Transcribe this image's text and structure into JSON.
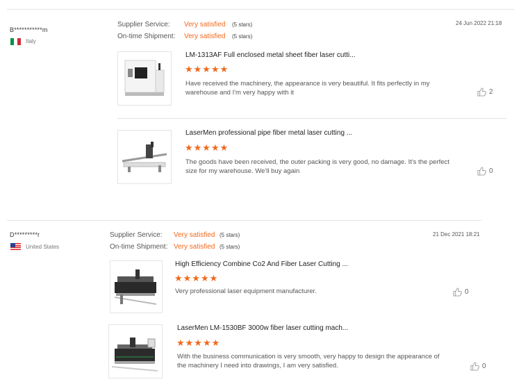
{
  "reviews": [
    {
      "user": "B***********m",
      "country": "Italy",
      "supplier_label": "Supplier Service:",
      "supplier_value": "Very satisfied",
      "supplier_stars": "(5 stars)",
      "shipment_label": "On-time Shipment:",
      "shipment_value": "Very satisfied",
      "shipment_stars": "(5 stars)",
      "date": "24 Jun 2022 21:18",
      "items": [
        {
          "title": "LM-1313AF Full enclosed metal sheet fiber laser cutti...",
          "stars": "★★★★★",
          "text": "Have received the machinery, the appearance is very beautiful. It fits perfectly in my warehouse and I'm very happy with it",
          "likes": "2"
        },
        {
          "title": "LaserMen professional pipe fiber metal laser cutting ...",
          "stars": "★★★★★",
          "text": "The goods have been received, the outer packing is very good, no damage. It's the perfect size for my warehouse. We'll buy again",
          "likes": "0"
        }
      ]
    },
    {
      "user": "D*********r",
      "country": "United States",
      "supplier_label": "Supplier Service:",
      "supplier_value": "Very satisfied",
      "supplier_stars": "(5 stars)",
      "shipment_label": "On-time Shipment:",
      "shipment_value": "Very satisfied",
      "shipment_stars": "(5 stars)",
      "date": "21 Dec 2021 18:21",
      "items": [
        {
          "title": "High Efficiency Combine Co2 And Fiber Laser Cutting ...",
          "stars": "★★★★★",
          "text": "Very professional laser equipment manufacturer.",
          "likes": "0"
        },
        {
          "title": "LaserMen LM-1530BF 3000w fiber laser cutting mach...",
          "stars": "★★★★★",
          "text": "With the business communication is very smooth, very happy to design the appearance of the machinery I need into drawings, I am very satisfied.",
          "likes": "0"
        }
      ]
    }
  ],
  "colors": {
    "accent": "#f0691c",
    "divider": "#e3e3e3"
  },
  "icons": {
    "like": "thumbs-up-icon"
  }
}
